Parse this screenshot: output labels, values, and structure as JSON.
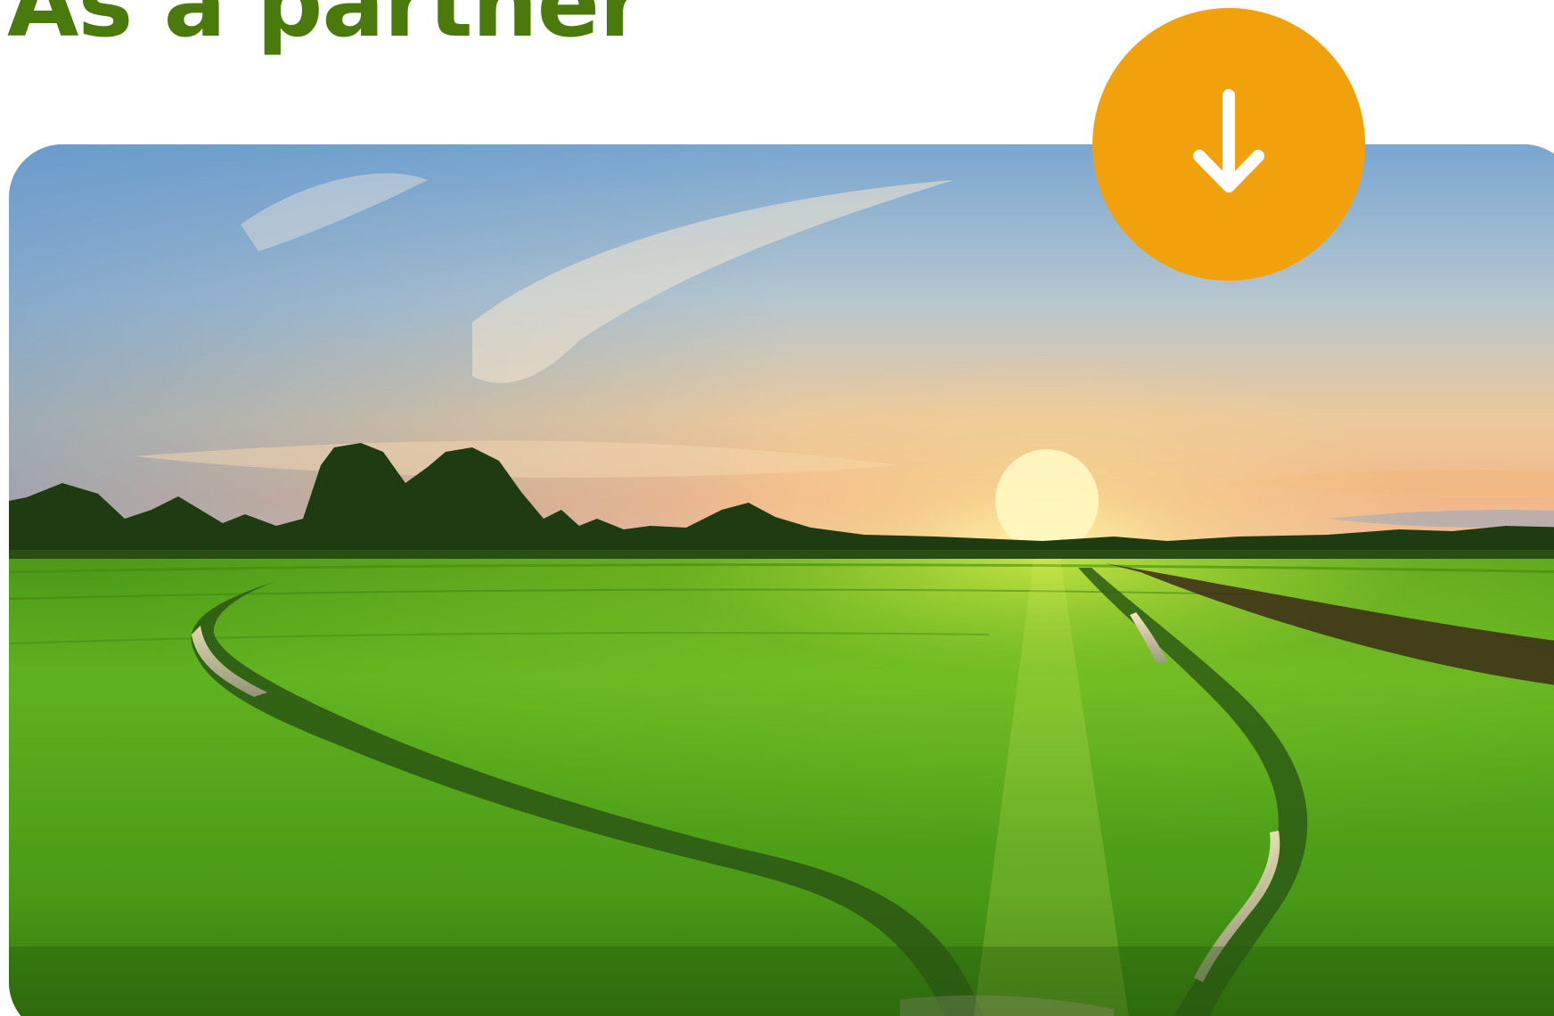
{
  "section": {
    "heading": "As a partner"
  },
  "hero": {
    "image_subject": "rice-field-sunset",
    "colors": {
      "sky_top": "#6d9cc9",
      "sky_horizon": "#f3c58f",
      "sun": "#fff3a0",
      "grass": "#5aa81c",
      "tree_line": "#1e3a12"
    }
  },
  "scroll_button": {
    "icon": "arrow-down-icon",
    "color": "#f1a10b"
  },
  "colors": {
    "heading": "#4a7a0c",
    "background": "#ffffff"
  }
}
